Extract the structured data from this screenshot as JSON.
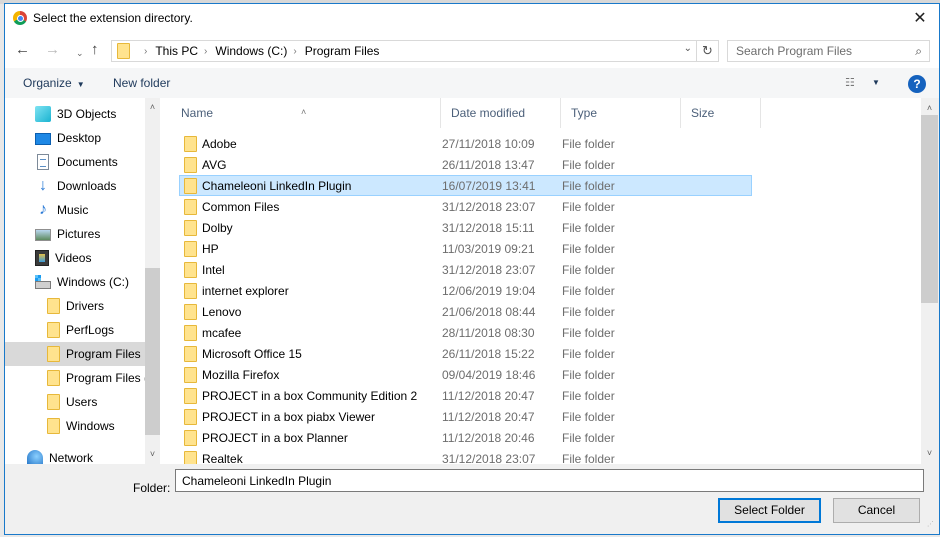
{
  "dialog": {
    "title": "Select the extension directory.",
    "close_label": "✕",
    "accent_color": "#0078d7"
  },
  "navigation": {
    "back_icon": "←",
    "forward_icon": "→",
    "recent_icon": "⌄",
    "up_icon": "↑",
    "breadcrumb": [
      "This PC",
      "Windows (C:)",
      "Program Files"
    ],
    "breadcrumb_separator": "›",
    "dropdown_icon": "⌄",
    "refresh_icon": "↻",
    "search_placeholder": "Search Program Files",
    "search_icon": "⌕"
  },
  "command_bar": {
    "organize_label": "Organize",
    "organize_caret": "▼",
    "new_folder_label": "New folder",
    "view_icon": "☷",
    "view_caret": "▼",
    "help_label": "?"
  },
  "nav_pane": {
    "items": [
      {
        "label": "3D Objects",
        "icon": "3d-objects-icon"
      },
      {
        "label": "Desktop",
        "icon": "desktop-icon"
      },
      {
        "label": "Documents",
        "icon": "documents-icon"
      },
      {
        "label": "Downloads",
        "icon": "downloads-icon"
      },
      {
        "label": "Music",
        "icon": "music-icon"
      },
      {
        "label": "Pictures",
        "icon": "pictures-icon"
      },
      {
        "label": "Videos",
        "icon": "videos-icon"
      },
      {
        "label": "Windows (C:)",
        "icon": "drive-icon"
      },
      {
        "label": "Drivers",
        "icon": "folder-icon"
      },
      {
        "label": "PerfLogs",
        "icon": "folder-icon"
      },
      {
        "label": "Program Files",
        "icon": "folder-icon",
        "selected": true
      },
      {
        "label": "Program Files (",
        "icon": "folder-icon"
      },
      {
        "label": "Users",
        "icon": "folder-icon"
      },
      {
        "label": "Windows",
        "icon": "folder-icon"
      },
      {
        "label": "Network",
        "icon": "network-icon"
      }
    ],
    "scroll_up": "˄",
    "scroll_down": "˅"
  },
  "file_list": {
    "columns": [
      "Name",
      "Date modified",
      "Type",
      "Size"
    ],
    "sort_indicator": "˄",
    "rows": [
      {
        "name": "Adobe",
        "date": "27/11/2018 10:09",
        "type": "File folder"
      },
      {
        "name": "AVG",
        "date": "26/11/2018 13:47",
        "type": "File folder"
      },
      {
        "name": "Chameleoni LinkedIn Plugin",
        "date": "16/07/2019 13:41",
        "type": "File folder",
        "selected": true
      },
      {
        "name": "Common Files",
        "date": "31/12/2018 23:07",
        "type": "File folder"
      },
      {
        "name": "Dolby",
        "date": "31/12/2018 15:11",
        "type": "File folder"
      },
      {
        "name": "HP",
        "date": "11/03/2019 09:21",
        "type": "File folder"
      },
      {
        "name": "Intel",
        "date": "31/12/2018 23:07",
        "type": "File folder"
      },
      {
        "name": "internet explorer",
        "date": "12/06/2019 19:04",
        "type": "File folder"
      },
      {
        "name": "Lenovo",
        "date": "21/06/2018 08:44",
        "type": "File folder"
      },
      {
        "name": "mcafee",
        "date": "28/11/2018 08:30",
        "type": "File folder"
      },
      {
        "name": "Microsoft Office 15",
        "date": "26/11/2018 15:22",
        "type": "File folder"
      },
      {
        "name": "Mozilla Firefox",
        "date": "09/04/2019 18:46",
        "type": "File folder"
      },
      {
        "name": "PROJECT in a box Community Edition 2",
        "date": "11/12/2018 20:47",
        "type": "File folder"
      },
      {
        "name": "PROJECT in a box piabx Viewer",
        "date": "11/12/2018 20:47",
        "type": "File folder"
      },
      {
        "name": "PROJECT in a box Planner",
        "date": "11/12/2018 20:46",
        "type": "File folder"
      },
      {
        "name": "Realtek",
        "date": "31/12/2018 23:07",
        "type": "File folder"
      }
    ],
    "scroll_up": "˄",
    "scroll_down": "˅"
  },
  "footer": {
    "folder_label": "Folder:",
    "folder_value": "Chameleoni LinkedIn Plugin",
    "select_button": "Select Folder",
    "cancel_button": "Cancel",
    "grip": "⋰"
  }
}
